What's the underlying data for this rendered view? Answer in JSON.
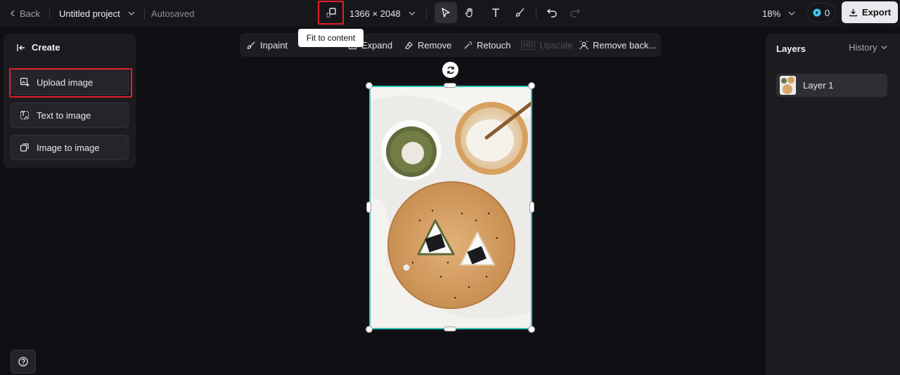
{
  "topbar": {
    "back_label": "Back",
    "project_name": "Untitled project",
    "save_status": "Autosaved",
    "canvas_size": "1366 × 2048",
    "zoom": "18%",
    "credits": "0",
    "export_label": "Export"
  },
  "tooltip": {
    "text": "Fit to content"
  },
  "left_panel": {
    "title": "Create",
    "buttons": [
      "Upload image",
      "Text to image",
      "Image to image"
    ]
  },
  "edit_toolbar": {
    "items": [
      "Inpaint",
      "Expand",
      "Remove",
      "Retouch",
      "Upscale",
      "Remove back..."
    ],
    "upscale_badge": "HD"
  },
  "right_panel": {
    "tab_layers": "Layers",
    "tab_history": "History",
    "layers": [
      "Layer 1"
    ]
  },
  "colors": {
    "accent_selection": "#2ec4b6",
    "highlight": "#e0202a",
    "credit_icon": "#3fc8f0"
  }
}
